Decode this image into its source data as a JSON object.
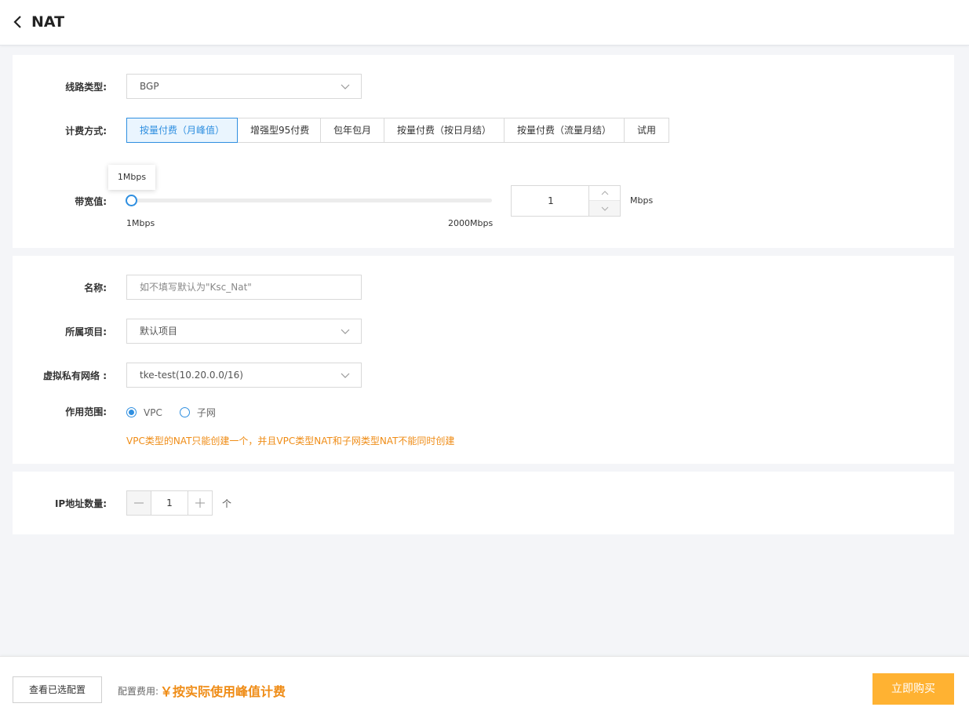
{
  "header": {
    "title": "NAT"
  },
  "line": {
    "label": "线路类型:",
    "value": "BGP"
  },
  "billing": {
    "label": "计费方式:",
    "options": [
      "按量付费（月峰值）",
      "增强型95付费",
      "包年包月",
      "按量付费（按日月结）",
      "按量付费（流量月结）",
      "试用"
    ],
    "selected_index": 0
  },
  "bandwidth": {
    "label": "带宽值:",
    "tooltip": "1Mbps",
    "min_label": "1Mbps",
    "max_label": "2000Mbps",
    "value": "1",
    "unit": "Mbps",
    "slider_fraction": 0
  },
  "name": {
    "label": "名称:",
    "placeholder": "如不填写默认为\"Ksc_Nat\""
  },
  "project": {
    "label": "所属项目:",
    "value": "默认项目"
  },
  "vpc": {
    "label": "虚拟私有网络 :",
    "value": "tke-test(10.20.0.0/16)"
  },
  "scope": {
    "label": "作用范围:",
    "options": [
      "VPC",
      "子网"
    ],
    "selected_index": 0,
    "warning": "VPC类型的NAT只能创建一个，并且VPC类型NAT和子网类型NAT不能同时创建"
  },
  "ip_count": {
    "label": "IP地址数量:",
    "value": "1",
    "unit": "个"
  },
  "footer": {
    "view_config": "查看已选配置",
    "fee_label": "配置费用:",
    "fee_value": "￥按实际使用峰值计费",
    "buy": "立即购买"
  },
  "colors": {
    "accent": "#2f8fe0",
    "warning": "#ef8c16",
    "buy_button": "#ffb232"
  }
}
